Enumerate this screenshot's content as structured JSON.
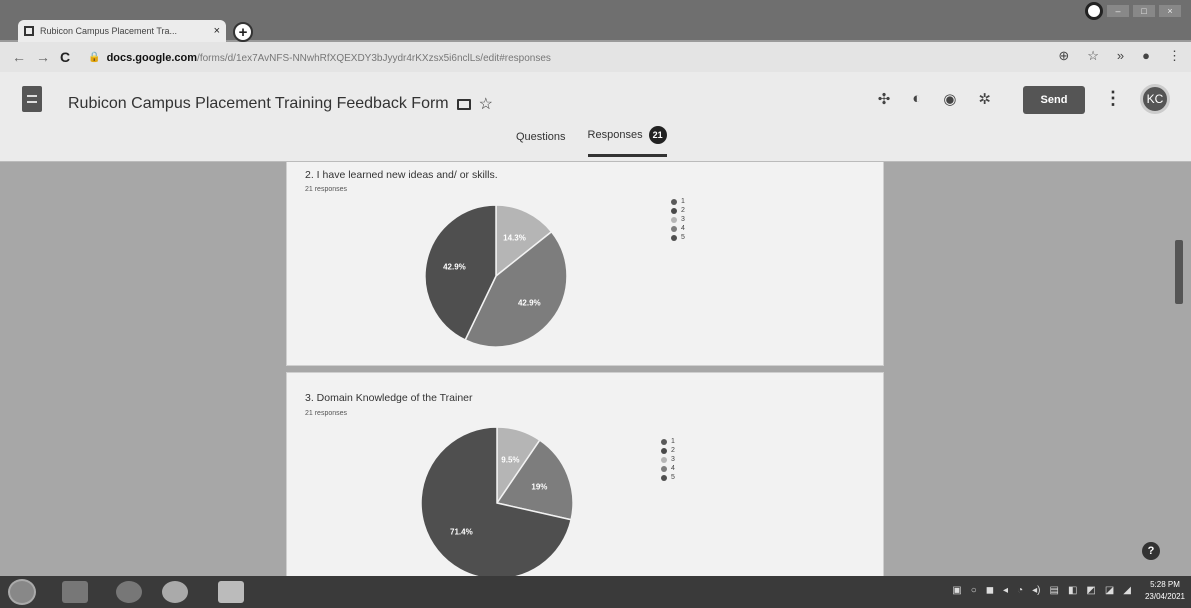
{
  "browser": {
    "tab_title": "Rubicon Campus Placement Tra...",
    "tab_close": "×",
    "new_tab": "+",
    "url_domain": "docs.google.com",
    "url_path": "/forms/d/1ex7AvNFS-NNwhRfXQEXDY3bJyydr4rKXzsx5i6nclLs/edit#responses"
  },
  "forms": {
    "title": "Rubicon Campus Placement Training Feedback Form",
    "send_label": "Send",
    "avatar_initials": "KC",
    "tabs": [
      {
        "label": "Questions"
      },
      {
        "label": "Responses",
        "count": "21"
      }
    ]
  },
  "questions": [
    {
      "title": "2. I have learned new ideas and/ or skills.",
      "responses": "21 responses",
      "chart_data": {
        "type": "pie",
        "labels": [
          "1",
          "2",
          "3",
          "4",
          "5"
        ],
        "values": [
          0,
          0,
          14.3,
          42.9,
          42.9
        ],
        "slice_labels": [
          "",
          "",
          "14.3%",
          "42.9%",
          "42.9%"
        ],
        "colors": [
          "#5a5a5a",
          "#4a4a4a",
          "#b5b5b5",
          "#7d7d7d",
          "#4f4f4f"
        ]
      }
    },
    {
      "title": "3. Domain Knowledge of the Trainer",
      "responses": "21 responses",
      "chart_data": {
        "type": "pie",
        "labels": [
          "1",
          "2",
          "3",
          "4",
          "5"
        ],
        "values": [
          0,
          0,
          9.5,
          19,
          71.4
        ],
        "slice_labels": [
          "",
          "",
          "9.5%",
          "19%",
          "71.4%"
        ],
        "colors": [
          "#5a5a5a",
          "#4a4a4a",
          "#b5b5b5",
          "#7d7d7d",
          "#4f4f4f"
        ]
      }
    }
  ],
  "taskbar": {
    "time": "5:28 PM",
    "date": "23/04/2021"
  }
}
